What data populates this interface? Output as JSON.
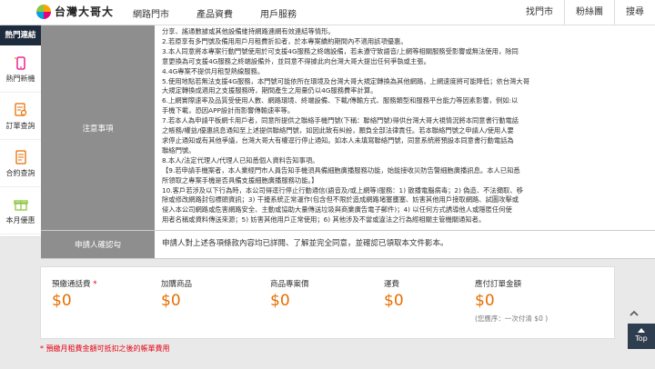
{
  "header": {
    "brand": "台灣大哥大",
    "nav": [
      "網路門市",
      "產品資費",
      "用戶服務"
    ],
    "right": [
      "找門市",
      "粉絲團",
      "搜尋"
    ]
  },
  "sidebar": {
    "title": "熱門連結",
    "items": [
      {
        "label": "熱門新機",
        "icon": "phone-sparkle-icon"
      },
      {
        "label": "訂單查詢",
        "icon": "order-search-icon"
      },
      {
        "label": "合約查詢",
        "icon": "contract-icon"
      },
      {
        "label": "本月優惠",
        "icon": "gift-icon"
      }
    ]
  },
  "notes": {
    "label": "注意事項",
    "lines": [
      "分享、謠通數據或其他設備維持網路連網有效連結等情形。",
      "2.若原享有多門號及備用用戶月租費折扣者，於本專案續約期間內不適用該項優惠。",
      "3.本人同意將本專案行動門號使用於可支援4G服務之終端設備，若未遵守致語音/上網等相關服務受影響或無法使用，除同",
      "意更換為可支援4G服務之終端設備外，並同意不得據此向台灣大哥大提出任何爭執或主張。",
      "4.4G專案不提供月租型熱線服務。",
      "5.使用地點若無法支援4G服務，本門號可能依所在環境及台灣大哥大規定轉換為其他網路，上網速度將可能降低；依台灣大哥",
      "大規定轉換成適用之支援服務時，期間產生之用量仍以4G服務費率計算。",
      "6.上網實際速率及品質受使用人數、網路環境、終端設備、下載/傳輸方式、服務類型和服務平台能力等因素影響，例如:以",
      "手機下載，恐因APP設計而影響傳輸速率等。",
      "7.若本人為申請平板網卡用戶者，同意所提供之聯絡手機門號(下稱：聯絡門號)得供台灣大哥大視情況將本同意書行動電話",
      "之帳務/權益/優惠訊息通知至上述提供聯絡門號，如因此致有糾紛，願負全部法律責任。若本聯絡門號之申請人/使用人要",
      "求停止通知或有其他爭議，台灣大哥大有權逕行停止通知。如本人未填寫聯絡門號，同意系統將預設本同意書行動電話為",
      "聯絡門號。",
      "8.本人/法定代理人/代理人已知悉個人資料告知事項。",
      "【9.若申請手機案者，本人業經門市人員告知手機須具備細胞廣播服務功能，始能接收災防告警細胞廣播訊息。本人已知悉",
      "所領取之專案手機是否具備支援細胞廣播服務功能。】",
      "10.客戶若涉及以下行為時，本公司得逕行停止行動通信(語音及/或上網等)服務：1) 散播電腦病毒；2) 偽造、不法擷取、移",
      "除或修改網路封包標頭資訊；3) 干擾系統正常運作(包含但不限於造成網路堵塞壅塞、妨害其他用戶接取網路、試圖攻擊或",
      "侵入本公司網路或危害網路安全、主動或協助大量傳送垃圾與商業廣告電子郵件)；4) 以任何方式誘導他人或隱匿任何使",
      "用者名稱或資料傳送來源；5) 妨害其他用戶正常使用；6) 其他涉及不當或違法之行為經相關主管機關通知者。"
    ]
  },
  "confirm": {
    "label": "申請人確認勾",
    "text": "申請人對上述各項條款內容均已詳閱、了解並完全同意，並確認已領取本文件影本。"
  },
  "summary": [
    {
      "label": "預繳通話費",
      "required": "*",
      "value": "$0"
    },
    {
      "label": "加購商品",
      "value": "$0"
    },
    {
      "label": "商品專案價",
      "value": "$0"
    },
    {
      "label": "運費",
      "value": "$0"
    },
    {
      "label": "應付訂單金額",
      "value": "$0",
      "sub": "(您應序：一次付清 $0 )"
    }
  ],
  "footnote": "* 預繳月租費金額可抵扣之後的帳單費用",
  "top_button": "Top",
  "colors": {
    "accent": "#e76e00",
    "sidebar_head": "#1e2b3c",
    "label_bg": "#8e8e8e",
    "required": "#e60012"
  }
}
